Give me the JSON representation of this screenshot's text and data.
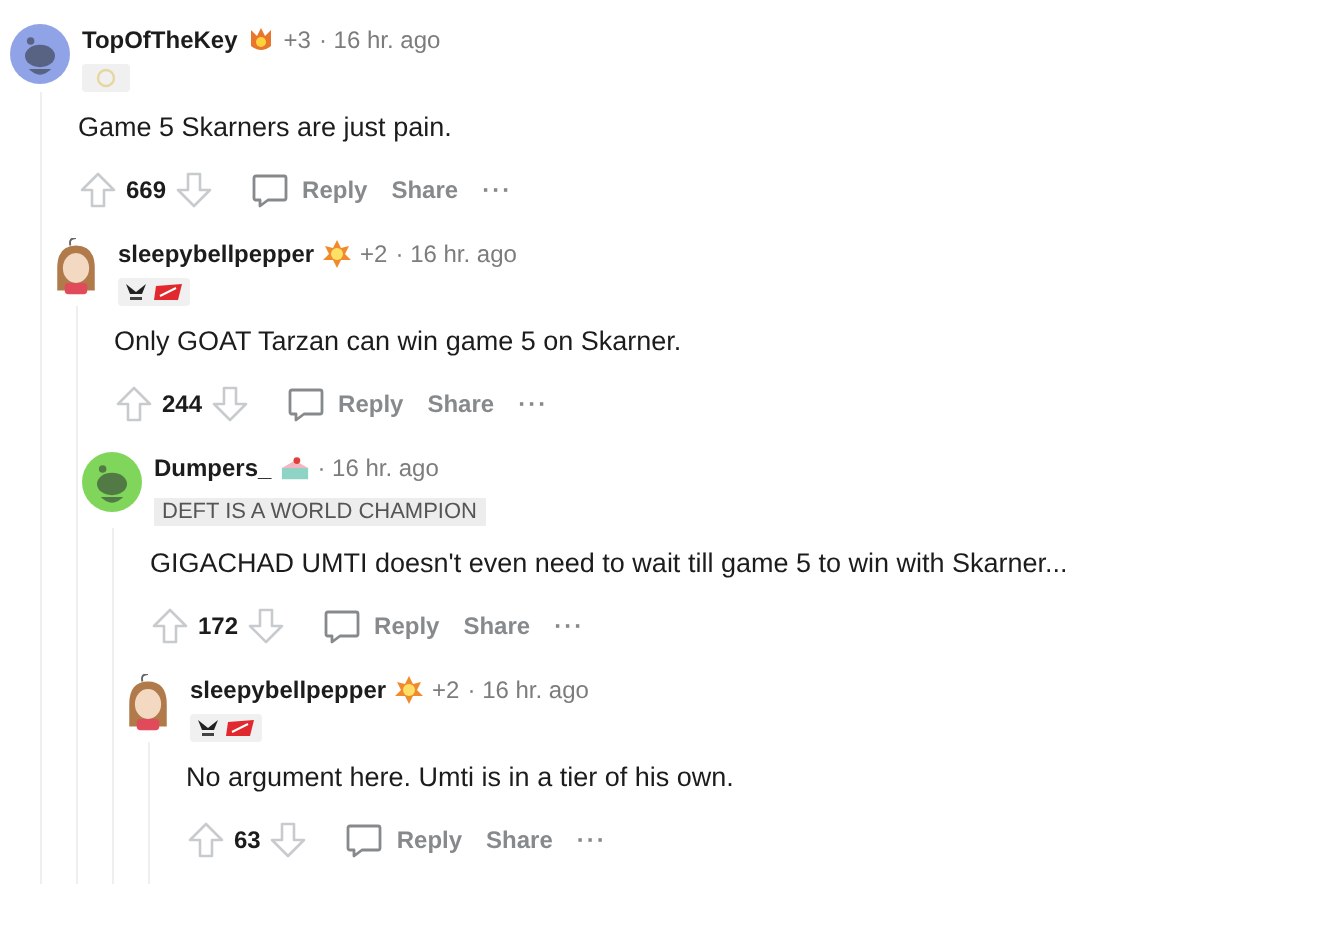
{
  "comments": [
    {
      "author": "TopOfTheKey",
      "avatar": {
        "kind": "snoo",
        "color": "#8fa3e6"
      },
      "award": {
        "kind": "fire"
      },
      "award_count": "+3",
      "time": "· 16 hr. ago",
      "flair": {
        "kind": "emblem"
      },
      "body": "Game 5 Skarners are just pain.",
      "score": "669",
      "actions": [
        "Reply",
        "Share"
      ],
      "more": "···",
      "children": [
        {
          "author": "sleepybellpepper",
          "avatar": {
            "kind": "character",
            "color": "#b07a4a"
          },
          "award": {
            "kind": "burst"
          },
          "award_count": "+2",
          "time": "· 16 hr. ago",
          "flair": {
            "kind": "logos"
          },
          "body": "Only GOAT Tarzan can win game 5 on Skarner.",
          "score": "244",
          "actions": [
            "Reply",
            "Share"
          ],
          "more": "···",
          "children": [
            {
              "author": "Dumpers_",
              "avatar": {
                "kind": "snoo",
                "color": "#7fd65a"
              },
              "award": {
                "kind": "cake"
              },
              "time": "· 16 hr. ago",
              "flair": {
                "kind": "text",
                "text": "DEFT IS A WORLD CHAMPION"
              },
              "body": "GIGACHAD UMTI doesn't even need to wait till game 5 to win with Skarner...",
              "score": "172",
              "actions": [
                "Reply",
                "Share"
              ],
              "more": "···",
              "children": [
                {
                  "author": "sleepybellpepper",
                  "avatar": {
                    "kind": "character",
                    "color": "#b07a4a"
                  },
                  "award": {
                    "kind": "burst"
                  },
                  "award_count": "+2",
                  "time": "· 16 hr. ago",
                  "flair": {
                    "kind": "logos"
                  },
                  "body": "No argument here. Umti is in a tier of his own.",
                  "score": "63",
                  "actions": [
                    "Reply",
                    "Share"
                  ],
                  "more": "···"
                }
              ]
            }
          ]
        }
      ]
    }
  ]
}
